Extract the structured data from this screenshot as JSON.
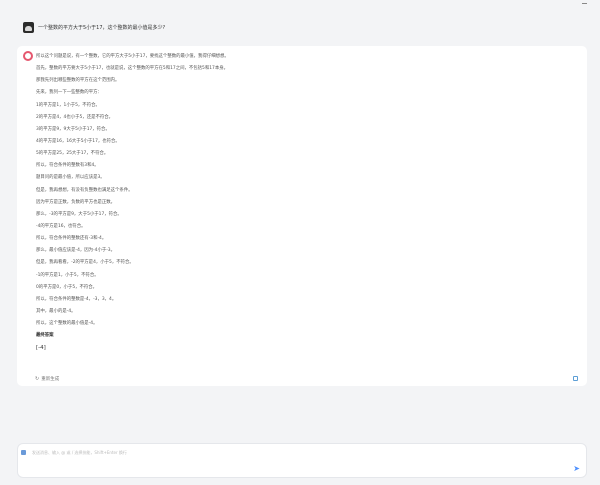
{
  "question": {
    "text": "一个整数的平方大于5小于17，这个整数的最小值是多少?"
  },
  "answer": {
    "lines": [
      "所以这个问题是说，有一个整数，它的平方大于5小于17，要找这个整数的最小值，我得仔细想想。",
      "首先，整数的平方要大于5小于17，也就是说，这个整数的平方在5和17之间，不包括5和17本身。",
      "那我先列出哪些整数的平方在这个范围内。",
      "先来，我列一下一些整数的平方：",
      "1的平方是1，1小于5，不符合。",
      "2的平方是4，4也小于5，还是不符合。",
      "3的平方是9，9大于5小于17，符合。",
      "4的平方是16，16大于5小于17，也符合。",
      "5的平方是25，25大于17，不符合。",
      "所以，符合条件的整数有3和4。",
      "题目问的是最小值，所以应该是3。",
      "但是，我再想想，有没有负整数也满足这个条件。",
      "因为平方是正数，负数的平方也是正数。",
      "那么，-3的平方是9，大于5小于17，符合。",
      "-4的平方是16，也符合。",
      "所以，符合条件的整数还有-3和-4。",
      "那么，最小值应该是-4，因为-4小于-3。",
      "但是，我再看看，-2的平方是4，小于5，不符合。",
      "-1的平方是1，小于5，不符合。",
      "0的平方是0，小于5，不符合。",
      "所以，符合条件的整数是-4，-3，3，4。",
      "其中，最小的是-4。",
      "所以，这个整数的最小值是-4。"
    ],
    "final_heading": "最终答案",
    "final_answer": "[-4]"
  },
  "actions": {
    "regenerate_label": "重新生成"
  },
  "input": {
    "placeholder": "发送消息、输入 @ 或 / 选择技能，Shift+Enter 换行"
  }
}
